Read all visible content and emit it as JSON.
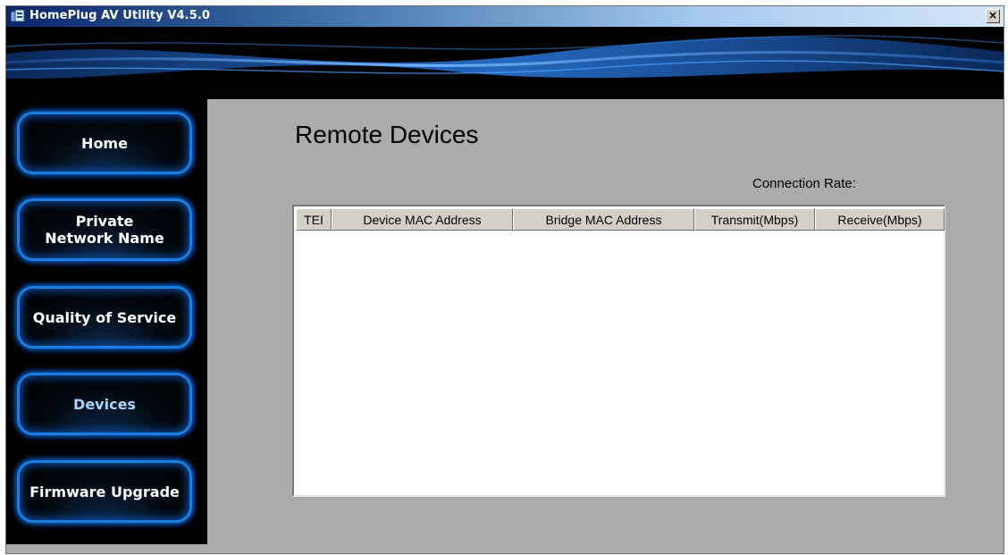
{
  "window": {
    "title": "HomePlug AV Utility V4.5.0",
    "close_label": "×"
  },
  "sidebar": {
    "items": [
      {
        "label": "Home",
        "active": false
      },
      {
        "label": "Private\nNetwork Name",
        "active": false
      },
      {
        "label": "Quality of Service",
        "active": false
      },
      {
        "label": "Devices",
        "active": true
      },
      {
        "label": "Firmware Upgrade",
        "active": false
      }
    ]
  },
  "main": {
    "title": "Remote Devices",
    "connection_rate_label": "Connection Rate:",
    "table": {
      "columns": [
        "TEI",
        "Device MAC Address",
        "Bridge MAC Address",
        "Transmit(Mbps)",
        "Receive(Mbps)"
      ],
      "rows": []
    }
  },
  "colors": {
    "accent": "#1a7fe0",
    "background": "#ababab",
    "sidebar": "#000000"
  },
  "icons": {
    "app": "homeplug-app-icon",
    "close": "close-icon"
  }
}
